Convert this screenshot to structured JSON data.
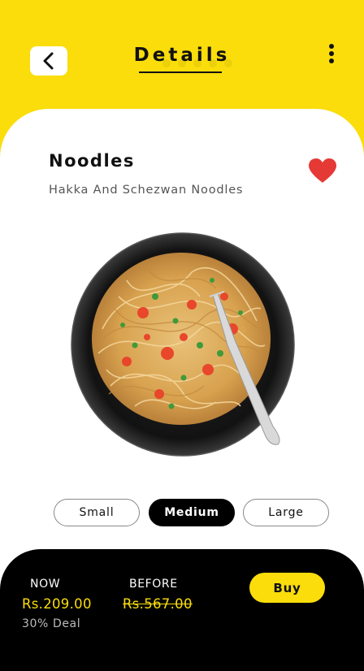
{
  "header": {
    "title": "Details",
    "back_icon": "chevron-left-icon",
    "menu_icon": "more-vertical-icon"
  },
  "product": {
    "name": "Noodles",
    "subtitle": "Hakka And Schezwan Noodles",
    "favorite": true,
    "favorite_icon": "heart-icon",
    "favorite_color": "#E53935"
  },
  "sizes": {
    "options": [
      "Small",
      "Medium",
      "Large"
    ],
    "selected": "Medium"
  },
  "pricing": {
    "now_label": "NOW",
    "now_price": "Rs.209.00",
    "before_label": "BEFORE",
    "before_price": "Rs.567.00",
    "deal": "30% Deal",
    "buy_label": "Buy"
  },
  "colors": {
    "accent": "#FADD0B",
    "dark": "#000000",
    "surface": "#FFFFFF"
  }
}
